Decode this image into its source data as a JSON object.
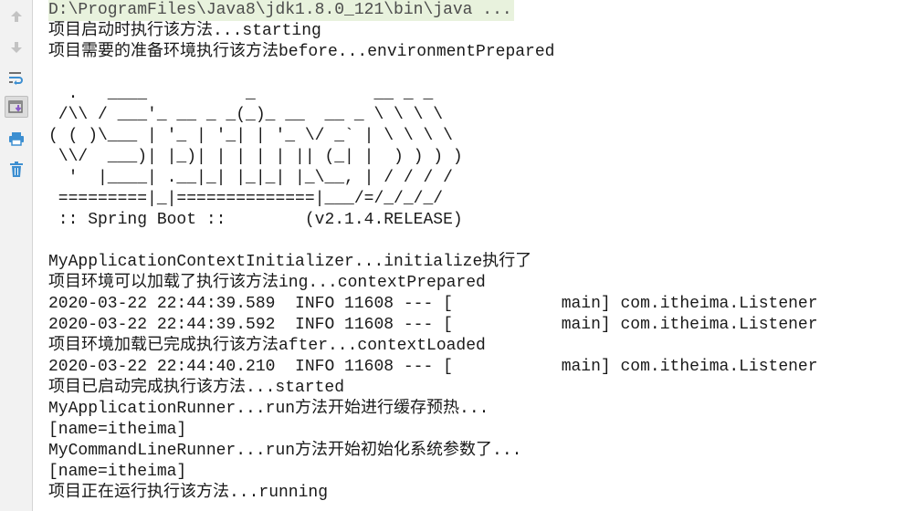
{
  "toolbar": {
    "buttons": [
      {
        "icon": "arrow-up-icon",
        "active": false
      },
      {
        "icon": "arrow-down-icon",
        "active": false
      },
      {
        "icon": "soft-wrap-icon",
        "active": false
      },
      {
        "icon": "scroll-to-end-icon",
        "active": true
      },
      {
        "icon": "print-icon",
        "active": false
      },
      {
        "icon": "trash-icon",
        "active": false
      }
    ]
  },
  "console": {
    "command": "D:\\ProgramFiles\\Java8\\jdk1.8.0_121\\bin\\java ...",
    "lines": [
      "项目启动时执行该方法...starting",
      "项目需要的准备环境执行该方法before...environmentPrepared",
      "",
      "  .   ____          _            __ _ _",
      " /\\\\ / ___'_ __ _ _(_)_ __  __ _ \\ \\ \\ \\",
      "( ( )\\___ | '_ | '_| | '_ \\/ _` | \\ \\ \\ \\",
      " \\\\/  ___)| |_)| | | | | || (_| |  ) ) ) )",
      "  '  |____| .__|_| |_|_| |_\\__, | / / / /",
      " =========|_|==============|___/=/_/_/_/",
      " :: Spring Boot ::        (v2.1.4.RELEASE)",
      "",
      "MyApplicationContextInitializer...initialize执行了",
      "项目环境可以加载了执行该方法ing...contextPrepared",
      "2020-03-22 22:44:39.589  INFO 11608 --- [           main] com.itheima.Listener",
      "2020-03-22 22:44:39.592  INFO 11608 --- [           main] com.itheima.Listener",
      "项目环境加载已完成执行该方法after...contextLoaded",
      "2020-03-22 22:44:40.210  INFO 11608 --- [           main] com.itheima.Listener",
      "项目已启动完成执行该方法...started",
      "MyApplicationRunner...run方法开始进行缓存预热...",
      "[name=itheima]",
      "MyCommandLineRunner...run方法开始初始化系统参数了...",
      "[name=itheima]",
      "项目正在运行执行该方法...running"
    ]
  },
  "colors": {
    "command_bg": "#e8f2dd",
    "text": "#1a1a1a",
    "toolbar_bg": "#f2f2f2",
    "icon_blue": "#3d8fd1"
  }
}
